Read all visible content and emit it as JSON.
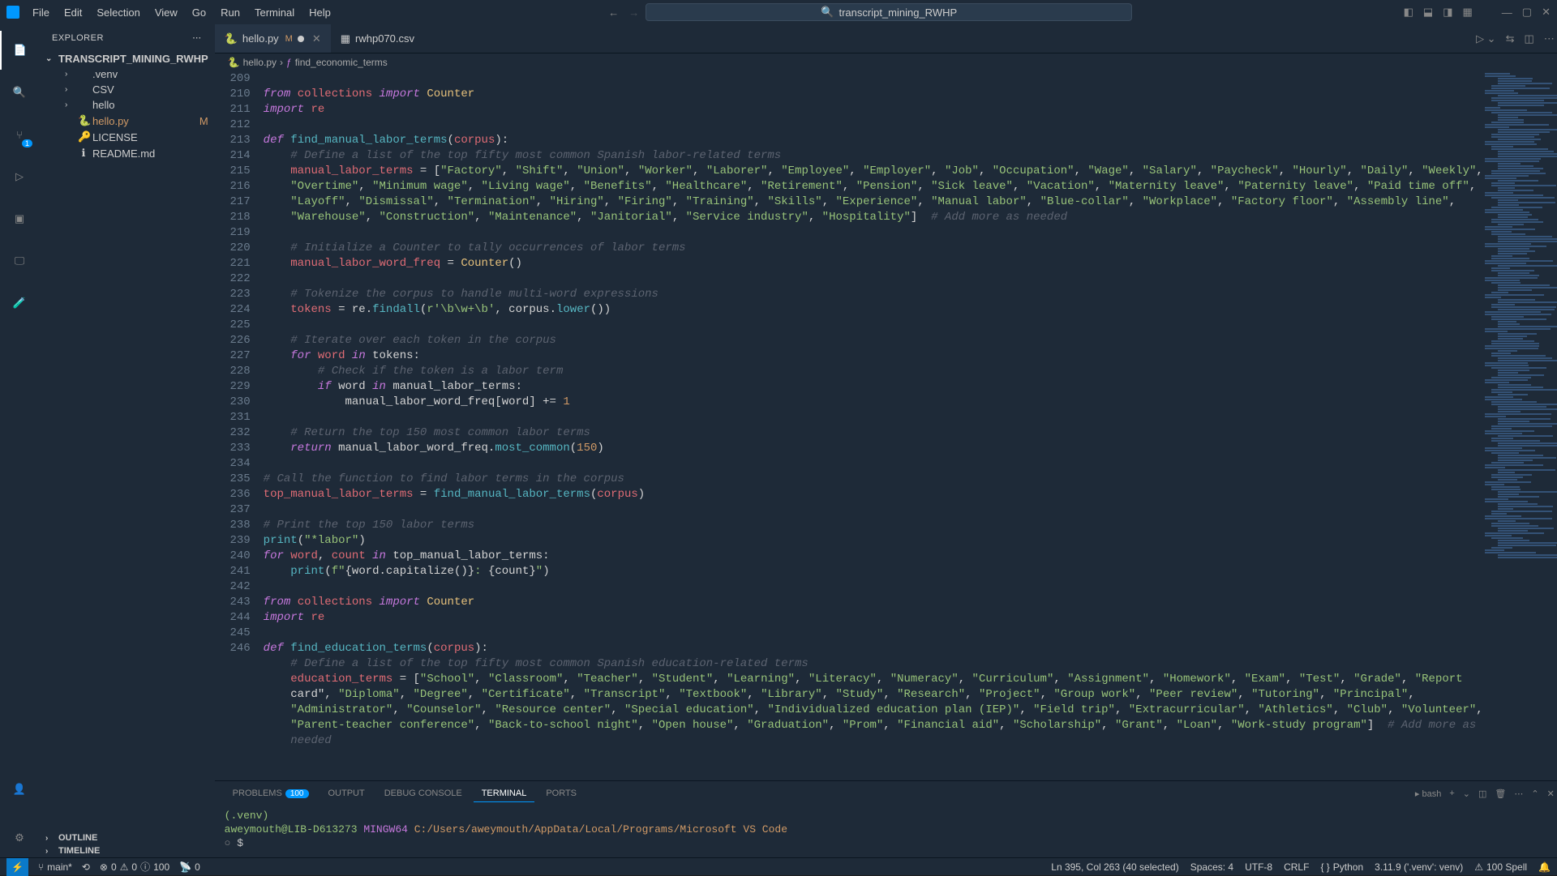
{
  "title": "transcript_mining_RWHP",
  "menu": [
    "File",
    "Edit",
    "Selection",
    "View",
    "Go",
    "Run",
    "Terminal",
    "Help"
  ],
  "sidebar": {
    "header": "EXPLORER",
    "root": "TRANSCRIPT_MINING_RWHP",
    "items": [
      {
        "type": "folder",
        "name": ".venv"
      },
      {
        "type": "folder",
        "name": "CSV"
      },
      {
        "type": "folder",
        "name": "hello"
      },
      {
        "type": "file",
        "name": "hello.py",
        "icon": "🐍",
        "modified": "M"
      },
      {
        "type": "file",
        "name": "LICENSE",
        "icon": "🔑"
      },
      {
        "type": "file",
        "name": "README.md",
        "icon": "ℹ"
      }
    ],
    "sections": [
      "OUTLINE",
      "TIMELINE"
    ]
  },
  "tabs": [
    {
      "name": "hello.py",
      "icon": "🐍",
      "mod": "M",
      "active": true,
      "dirty": true
    },
    {
      "name": "rwhp070.csv",
      "icon": "▦",
      "active": false
    }
  ],
  "breadcrumb": [
    "hello.py",
    "find_economic_terms"
  ],
  "code_lines": [
    {
      "n": 209,
      "html": ""
    },
    {
      "n": 210,
      "html": "<span class='kw'>from</span> <span class='var'>collections</span> <span class='kw'>import</span> <span class='cls'>Counter</span>"
    },
    {
      "n": 211,
      "html": "<span class='kw'>import</span> <span class='var'>re</span>"
    },
    {
      "n": 212,
      "html": ""
    },
    {
      "n": 213,
      "html": "<span class='kw'>def</span> <span class='fn'>find_manual_labor_terms</span>(<span class='var'>corpus</span>):"
    },
    {
      "n": 214,
      "html": "    <span class='cm'># Define a list of the top fifty most common Spanish labor-related terms</span>"
    },
    {
      "n": 215,
      "html": "    <span class='var'>manual_labor_terms</span> = [<span class='str'>\"Factory\"</span>, <span class='str'>\"Shift\"</span>, <span class='str'>\"Union\"</span>, <span class='str'>\"Worker\"</span>, <span class='str'>\"Laborer\"</span>, <span class='str'>\"Employee\"</span>, <span class='str'>\"Employer\"</span>, <span class='str'>\"Job\"</span>, <span class='str'>\"Occupation\"</span>, <span class='str'>\"Wage\"</span>, <span class='str'>\"Salary\"</span>, <span class='str'>\"Paycheck\"</span>, <span class='str'>\"Hourly\"</span>, <span class='str'>\"Daily\"</span>, <span class='str'>\"Weekly\"</span>,"
    },
    {
      "n": "",
      "html": "    <span class='str'>\"Overtime\"</span>, <span class='str'>\"Minimum wage\"</span>, <span class='str'>\"Living wage\"</span>, <span class='str'>\"Benefits\"</span>, <span class='str'>\"Healthcare\"</span>, <span class='str'>\"Retirement\"</span>, <span class='str'>\"Pension\"</span>, <span class='str'>\"Sick leave\"</span>, <span class='str'>\"Vacation\"</span>, <span class='str'>\"Maternity leave\"</span>, <span class='str'>\"Paternity leave\"</span>, <span class='str'>\"Paid time off\"</span>,"
    },
    {
      "n": "",
      "html": "    <span class='str'>\"Layoff\"</span>, <span class='str'>\"Dismissal\"</span>, <span class='str'>\"Termination\"</span>, <span class='str'>\"Hiring\"</span>, <span class='str'>\"Firing\"</span>, <span class='str'>\"Training\"</span>, <span class='str'>\"Skills\"</span>, <span class='str'>\"Experience\"</span>, <span class='str'>\"Manual labor\"</span>, <span class='str'>\"Blue-collar\"</span>, <span class='str'>\"Workplace\"</span>, <span class='str'>\"Factory floor\"</span>, <span class='str'>\"Assembly line\"</span>,"
    },
    {
      "n": "",
      "html": "    <span class='str'>\"Warehouse\"</span>, <span class='str'>\"Construction\"</span>, <span class='str'>\"Maintenance\"</span>, <span class='str'>\"Janitorial\"</span>, <span class='str'>\"Service industry\"</span>, <span class='str'>\"Hospitality\"</span>]  <span class='cm'># Add more as needed</span>"
    },
    {
      "n": 216,
      "html": ""
    },
    {
      "n": 217,
      "html": "    <span class='cm'># Initialize a Counter to tally occurrences of labor terms</span>"
    },
    {
      "n": 218,
      "html": "    <span class='var'>manual_labor_word_freq</span> = <span class='cls'>Counter</span>()"
    },
    {
      "n": 219,
      "html": ""
    },
    {
      "n": 220,
      "html": "    <span class='cm'># Tokenize the corpus to handle multi-word expressions</span>"
    },
    {
      "n": 221,
      "html": "    <span class='var'>tokens</span> = re.<span class='fn'>findall</span>(<span class='str'>r'\\b\\w+\\b'</span>, corpus.<span class='fn'>lower</span>())"
    },
    {
      "n": 222,
      "html": ""
    },
    {
      "n": 223,
      "html": "    <span class='cm'># Iterate over each token in the corpus</span>"
    },
    {
      "n": 224,
      "html": "    <span class='kw'>for</span> <span class='var'>word</span> <span class='kw'>in</span> tokens:"
    },
    {
      "n": 225,
      "html": "        <span class='cm'># Check if the token is a labor term</span>"
    },
    {
      "n": 226,
      "html": "        <span class='kw'>if</span> word <span class='kw'>in</span> manual_labor_terms:"
    },
    {
      "n": 227,
      "html": "            manual_labor_word_freq[word] += <span class='num'>1</span>"
    },
    {
      "n": 228,
      "html": ""
    },
    {
      "n": 229,
      "html": "    <span class='cm'># Return the top 150 most common labor terms</span>"
    },
    {
      "n": 230,
      "html": "    <span class='kw'>return</span> manual_labor_word_freq.<span class='fn'>most_common</span>(<span class='num'>150</span>)"
    },
    {
      "n": 231,
      "html": ""
    },
    {
      "n": 232,
      "html": "<span class='cm'># Call the function to find labor terms in the corpus</span>"
    },
    {
      "n": 233,
      "html": "<span class='var'>top_manual_labor_terms</span> = <span class='fn'>find_manual_labor_terms</span>(<span class='var'>corpus</span>)"
    },
    {
      "n": 234,
      "html": ""
    },
    {
      "n": 235,
      "html": "<span class='cm'># Print the top 150 labor terms</span>"
    },
    {
      "n": 236,
      "html": "<span class='fn'>print</span>(<span class='str'>\"*labor\"</span>)"
    },
    {
      "n": 237,
      "html": "<span class='kw'>for</span> <span class='var'>word</span>, <span class='var'>count</span> <span class='kw'>in</span> top_manual_labor_terms:"
    },
    {
      "n": 238,
      "html": "    <span class='fn'>print</span>(<span class='str'>f\"</span>{word.capitalize()}<span class='str'>: </span>{count}<span class='str'>\"</span>)"
    },
    {
      "n": 239,
      "html": ""
    },
    {
      "n": 240,
      "html": "<span class='kw'>from</span> <span class='var'>collections</span> <span class='kw'>import</span> <span class='cls'>Counter</span>"
    },
    {
      "n": 241,
      "html": "<span class='kw'>import</span> <span class='var'>re</span>"
    },
    {
      "n": 242,
      "html": ""
    },
    {
      "n": 243,
      "html": "<span class='kw'>def</span> <span class='fn'>find_education_terms</span>(<span class='var'>corpus</span>):"
    },
    {
      "n": 244,
      "html": "    <span class='cm'># Define a list of the top fifty most common Spanish education-related terms</span>"
    },
    {
      "n": 245,
      "html": "    <span class='var'>education_terms</span> = [<span class='str'>\"School\"</span>, <span class='str'>\"Classroom\"</span>, <span class='str'>\"Teacher\"</span>, <span class='str'>\"Student\"</span>, <span class='str'>\"Learning\"</span>, <span class='str'>\"Literacy\"</span>, <span class='str'>\"Numeracy\"</span>, <span class='str'>\"Curriculum\"</span>, <span class='str'>\"Assignment\"</span>, <span class='str'>\"Homework\"</span>, <span class='str'>\"Exam\"</span>, <span class='str'>\"Test\"</span>, <span class='str'>\"Grade\"</span>, <span class='str'>\"Report"
    },
    {
      "n": "",
      "html": "    card\"</span>, <span class='str'>\"Diploma\"</span>, <span class='str'>\"Degree\"</span>, <span class='str'>\"Certificate\"</span>, <span class='str'>\"Transcript\"</span>, <span class='str'>\"Textbook\"</span>, <span class='str'>\"Library\"</span>, <span class='str'>\"Study\"</span>, <span class='str'>\"Research\"</span>, <span class='str'>\"Project\"</span>, <span class='str'>\"Group work\"</span>, <span class='str'>\"Peer review\"</span>, <span class='str'>\"Tutoring\"</span>, <span class='str'>\"Principal\"</span>,"
    },
    {
      "n": "",
      "html": "    <span class='str'>\"Administrator\"</span>, <span class='str'>\"Counselor\"</span>, <span class='str'>\"Resource center\"</span>, <span class='str'>\"Special education\"</span>, <span class='str'>\"Individualized education plan (IEP)\"</span>, <span class='str'>\"Field trip\"</span>, <span class='str'>\"Extracurricular\"</span>, <span class='str'>\"Athletics\"</span>, <span class='str'>\"Club\"</span>, <span class='str'>\"Volunteer\"</span>,"
    },
    {
      "n": "",
      "html": "    <span class='str'>\"Parent-teacher conference\"</span>, <span class='str'>\"Back-to-school night\"</span>, <span class='str'>\"Open house\"</span>, <span class='str'>\"Graduation\"</span>, <span class='str'>\"Prom\"</span>, <span class='str'>\"Financial aid\"</span>, <span class='str'>\"Scholarship\"</span>, <span class='str'>\"Grant\"</span>, <span class='str'>\"Loan\"</span>, <span class='str'>\"Work-study program\"</span>]  <span class='cm'># Add more as</span>"
    },
    {
      "n": "",
      "html": "    <span class='cm'>needed</span>"
    },
    {
      "n": 246,
      "html": ""
    }
  ],
  "terminal": {
    "tabs": [
      {
        "name": "PROBLEMS",
        "badge": "100"
      },
      {
        "name": "OUTPUT"
      },
      {
        "name": "DEBUG CONSOLE"
      },
      {
        "name": "TERMINAL",
        "active": true
      },
      {
        "name": "PORTS"
      }
    ],
    "shell": "bash",
    "lines": [
      {
        "text": "(.venv)",
        "color": "#98c379"
      },
      {
        "html": "<span style='color:#98c379'>aweymouth@LIB-D613273</span> <span style='color:#c678dd'>MINGW64</span> <span style='color:#d19a66'>C:/Users/aweymouth/AppData/Local/Programs/Microsoft VS Code</span>"
      },
      {
        "html": "<span style='color:#888'>○</span> $ "
      }
    ]
  },
  "status": {
    "branch": "main*",
    "sync": "⟲",
    "errors": "0",
    "warnings": "0",
    "info": "100",
    "ports": "0",
    "cursor": "Ln 395, Col 263 (40 selected)",
    "spaces": "Spaces: 4",
    "encoding": "UTF-8",
    "eol": "CRLF",
    "lang": "Python",
    "interpreter": "3.11.9 ('.venv': venv)",
    "spell": "100 Spell"
  }
}
